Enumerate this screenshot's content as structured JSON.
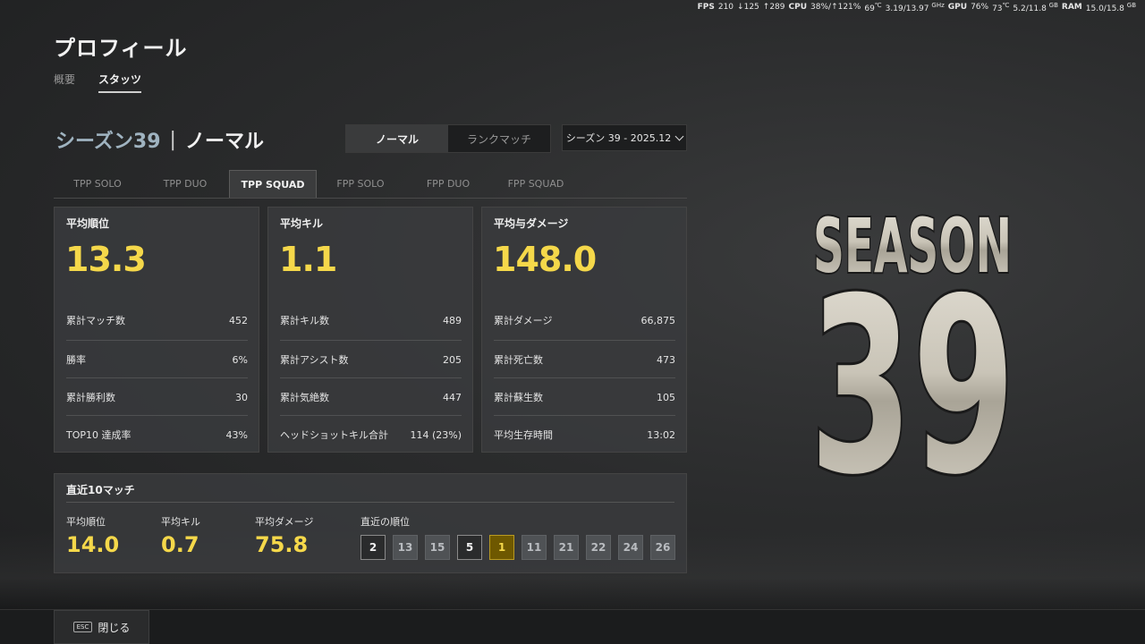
{
  "overlay": {
    "fps_label": "FPS",
    "fps": "210",
    "fps_low": "↓125",
    "fps_high": "↑289",
    "cpu_label": "CPU",
    "cpu_usage": "38%/↑121%",
    "cpu_temp": "69",
    "cpu_temp_unit": "℃",
    "cpu_clock": "3.19/13.97",
    "cpu_clock_unit": "GHz",
    "gpu_label": "GPU",
    "gpu_usage": "76%",
    "gpu_temp": "73",
    "gpu_temp_unit": "℃",
    "gpu_mem": "5.2/11.8",
    "gpu_mem_unit": "GB",
    "ram_label": "RAM",
    "ram": "15.0/15.8",
    "ram_unit": "GB"
  },
  "header": {
    "title": "プロフィール",
    "tabs": [
      {
        "label": "概要",
        "active": false
      },
      {
        "label": "スタッツ",
        "active": true
      }
    ]
  },
  "season_heading": {
    "season": "シーズン39",
    "separator": "|",
    "mode": "ノーマル"
  },
  "mode_toggle": {
    "options": [
      {
        "label": "ノーマル",
        "active": true
      },
      {
        "label": "ランクマッチ",
        "active": false
      }
    ]
  },
  "season_select": {
    "value": "シーズン 39 - 2025.12"
  },
  "mode_tabs": [
    {
      "label": "TPP SOLO",
      "active": false
    },
    {
      "label": "TPP DUO",
      "active": false
    },
    {
      "label": "TPP SQUAD",
      "active": true
    },
    {
      "label": "FPP SOLO",
      "active": false
    },
    {
      "label": "FPP DUO",
      "active": false
    },
    {
      "label": "FPP SQUAD",
      "active": false
    }
  ],
  "cards": [
    {
      "title": "平均順位",
      "main": "13.3",
      "rows": [
        {
          "label": "累計マッチ数",
          "value": "452"
        },
        {
          "label": "勝率",
          "value": "6%"
        },
        {
          "label": "累計勝利数",
          "value": "30"
        },
        {
          "label": "TOP10 達成率",
          "value": "43%"
        }
      ]
    },
    {
      "title": "平均キル",
      "main": "1.1",
      "rows": [
        {
          "label": "累計キル数",
          "value": "489"
        },
        {
          "label": "累計アシスト数",
          "value": "205"
        },
        {
          "label": "累計気絶数",
          "value": "447"
        },
        {
          "label": "ヘッドショットキル合計",
          "value": "114 (23%)"
        }
      ]
    },
    {
      "title": "平均与ダメージ",
      "main": "148.0",
      "rows": [
        {
          "label": "累計ダメージ",
          "value": "66,875"
        },
        {
          "label": "累計死亡数",
          "value": "473"
        },
        {
          "label": "累計蘇生数",
          "value": "105"
        },
        {
          "label": "平均生存時間",
          "value": "13:02"
        }
      ]
    }
  ],
  "recent": {
    "title": "直近10マッチ",
    "avg_rank_label": "平均順位",
    "avg_rank": "14.0",
    "avg_kill_label": "平均キル",
    "avg_kill": "0.7",
    "avg_damage_label": "平均ダメージ",
    "avg_damage": "75.8",
    "placements_label": "直近の順位",
    "placements": [
      {
        "rank": "2",
        "style": "top"
      },
      {
        "rank": "13",
        "style": "mid"
      },
      {
        "rank": "15",
        "style": "mid"
      },
      {
        "rank": "5",
        "style": "top"
      },
      {
        "rank": "1",
        "style": "win"
      },
      {
        "rank": "11",
        "style": "mid"
      },
      {
        "rank": "21",
        "style": "mid"
      },
      {
        "rank": "22",
        "style": "mid"
      },
      {
        "rank": "24",
        "style": "mid"
      },
      {
        "rank": "26",
        "style": "mid"
      }
    ]
  },
  "season_logo": {
    "word": "SEASON",
    "number": "39"
  },
  "footer": {
    "esc_key": "ESC",
    "close_label": "閉じる"
  },
  "colors": {
    "accent_yellow": "#f5d84a",
    "win_gold": "#6e5800",
    "season_blue": "#9fb3c0"
  }
}
